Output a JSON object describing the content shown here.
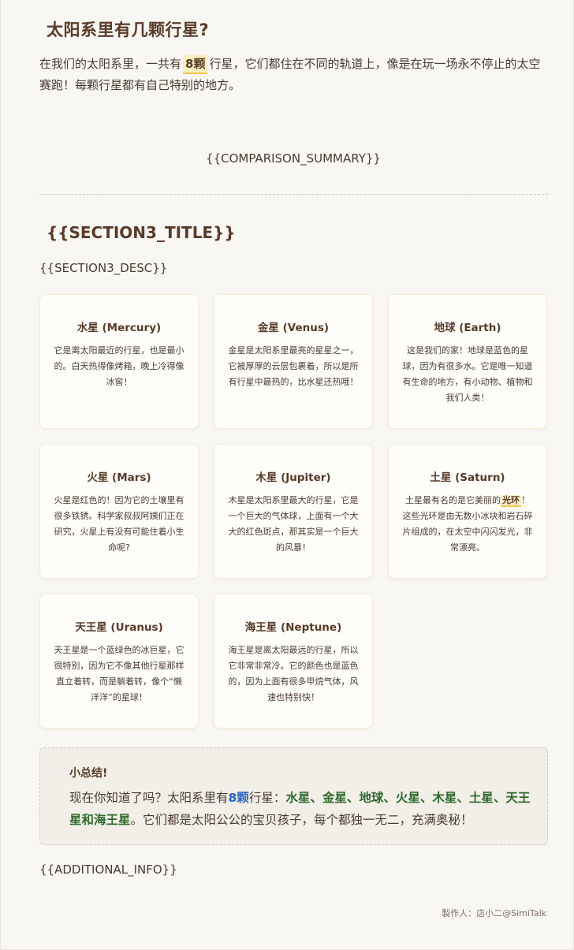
{
  "header": {
    "title": "太阳系里有几颗行星?",
    "intro_before": "在我们的太阳系里，一共有",
    "intro_highlight": "8颗",
    "intro_after": "行星，它们都住在不同的轨道上，像是在玩一场永不停止的太空赛跑！每颗行星都有自己特别的地方。"
  },
  "comparison_summary": "{{COMPARISON_SUMMARY}}",
  "section3": {
    "title": "{{SECTION3_TITLE}}",
    "desc": "{{SECTION3_DESC}}"
  },
  "planets": [
    {
      "name": "水星 (Mercury)",
      "text": "它是离太阳最近的行星，也是最小的。白天热得像烤箱，晚上冷得像冰窖！"
    },
    {
      "name": "金星 (Venus)",
      "text": "金星是太阳系里最亮的星星之一，它被厚厚的云层包裹着，所以是所有行星中最热的，比水星还热哦！"
    },
    {
      "name": "地球 (Earth)",
      "text": "这是我们的家！地球是蓝色的星球，因为有很多水。它是唯一知道有生命的地方，有小动物、植物和我们人类！"
    },
    {
      "name": "火星 (Mars)",
      "text": "火星是红色的！因为它的土壤里有很多铁锈。科学家叔叔阿姨们正在研究，火星上有没有可能住着小生命呢?"
    },
    {
      "name": "木星 (Jupiter)",
      "text": "木星是太阳系里最大的行星，它是一个巨大的气体球，上面有一个大大的红色斑点，那其实是一个巨大的风暴！"
    },
    {
      "name": "土星 (Saturn)",
      "text_before": "土星最有名的是它美丽的",
      "highlight": "光环",
      "text_after": "！这些光环是由无数小冰块和岩石碎片组成的，在太空中闪闪发光，非常漂亮。"
    },
    {
      "name": "天王星 (Uranus)",
      "text": "天王星是一个蓝绿色的冰巨星，它很特别，因为它不像其他行星那样直立着转，而是躺着转，像个“懒洋洋”的星球！"
    },
    {
      "name": "海王星 (Neptune)",
      "text": "海王星是离太阳最远的行星，所以它非常非常冷。它的颜色也是蓝色的，因为上面有很多甲烷气体，风速也特别快！"
    }
  ],
  "summary_box": {
    "title": "小总结!",
    "before": "现在你知道了吗？太阳系里有",
    "count": "8颗",
    "middle": "行星：",
    "list": "水星、金星、地球、火星、木星、土星、天王星和海王星",
    "after": "。它们都是太阳公公的宝贝孩子，每个都独一无二，充满奥秘！"
  },
  "additional_info": "{{ADDITIONAL_INFO}}",
  "credit": "製作人：店小二@SimiTalk",
  "colors": {
    "title": "#5a3a28",
    "highlight_bg": "#fbeec0",
    "blue": "#2a63c8",
    "green": "#2f6b2e",
    "background": "#f8f7f4"
  }
}
